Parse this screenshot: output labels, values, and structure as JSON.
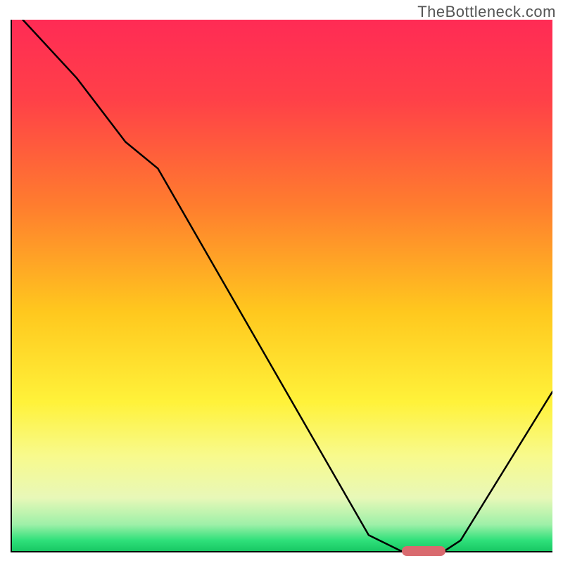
{
  "watermark": "TheBottleneck.com",
  "chart_data": {
    "type": "line",
    "title": "",
    "xlabel": "",
    "ylabel": "",
    "xlim": [
      0,
      100
    ],
    "ylim": [
      0,
      100
    ],
    "grid": false,
    "gradient_stops": [
      {
        "pct": 0,
        "color": "#ff2b55"
      },
      {
        "pct": 15,
        "color": "#ff4048"
      },
      {
        "pct": 35,
        "color": "#ff7d2e"
      },
      {
        "pct": 55,
        "color": "#ffc81e"
      },
      {
        "pct": 72,
        "color": "#fff23a"
      },
      {
        "pct": 82,
        "color": "#f8fa8c"
      },
      {
        "pct": 90,
        "color": "#e8f8b8"
      },
      {
        "pct": 95,
        "color": "#9ef0a8"
      },
      {
        "pct": 98,
        "color": "#2fe07a"
      },
      {
        "pct": 100,
        "color": "#18c864"
      }
    ],
    "series": [
      {
        "name": "bottleneck-curve",
        "x": [
          2,
          12,
          21,
          27,
          66,
          72,
          80,
          83,
          100
        ],
        "y": [
          100,
          89,
          77,
          72,
          3,
          0,
          0,
          2,
          30
        ]
      }
    ],
    "marker": {
      "name": "optimal-range",
      "x_start": 72,
      "x_end": 80,
      "y": 0,
      "color": "#d96a6f"
    }
  }
}
